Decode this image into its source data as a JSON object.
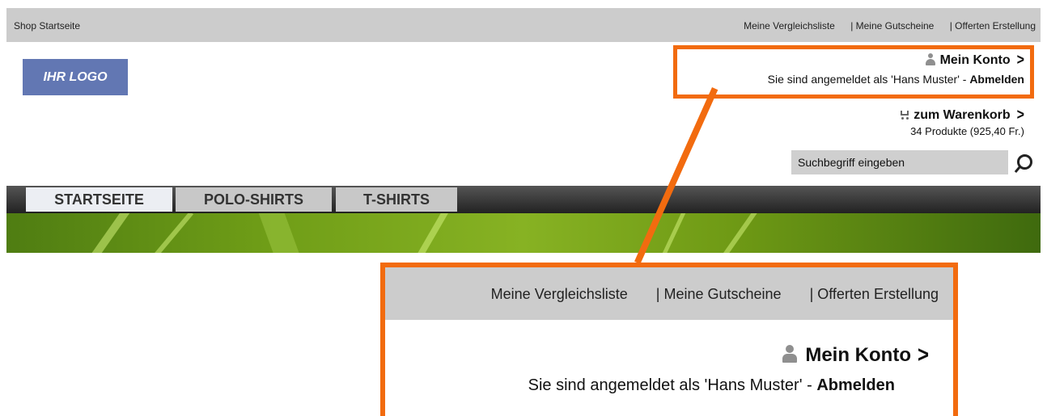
{
  "topbar": {
    "home_link": "Shop Startseite",
    "links": [
      "Meine Vergleichsliste",
      "| Meine Gutscheine",
      "| Offerten Erstellung"
    ]
  },
  "logo": {
    "text": "IHR LOGO"
  },
  "account": {
    "title": "Mein Konto",
    "logged_in_text": "Sie sind angemeldet als 'Hans Muster' - ",
    "logout_label": "Abmelden",
    "chevron": ">"
  },
  "cart": {
    "title": "zum Warenkorb",
    "summary": "34 Produkte (925,40 Fr.)",
    "chevron": ">"
  },
  "search": {
    "placeholder": "Suchbegriff eingeben"
  },
  "nav": {
    "tabs": [
      {
        "label": "STARTSEITE",
        "active": true
      },
      {
        "label": "POLO-SHIRTS",
        "active": false
      },
      {
        "label": "T-SHIRTS",
        "active": false
      }
    ]
  },
  "colors": {
    "accent": "#f26b0f",
    "logo_bg": "#6277b3",
    "bar_gray": "#cccccc"
  },
  "icons": [
    "user-icon",
    "cart-icon",
    "search-icon",
    "chevron-right-icon"
  ]
}
